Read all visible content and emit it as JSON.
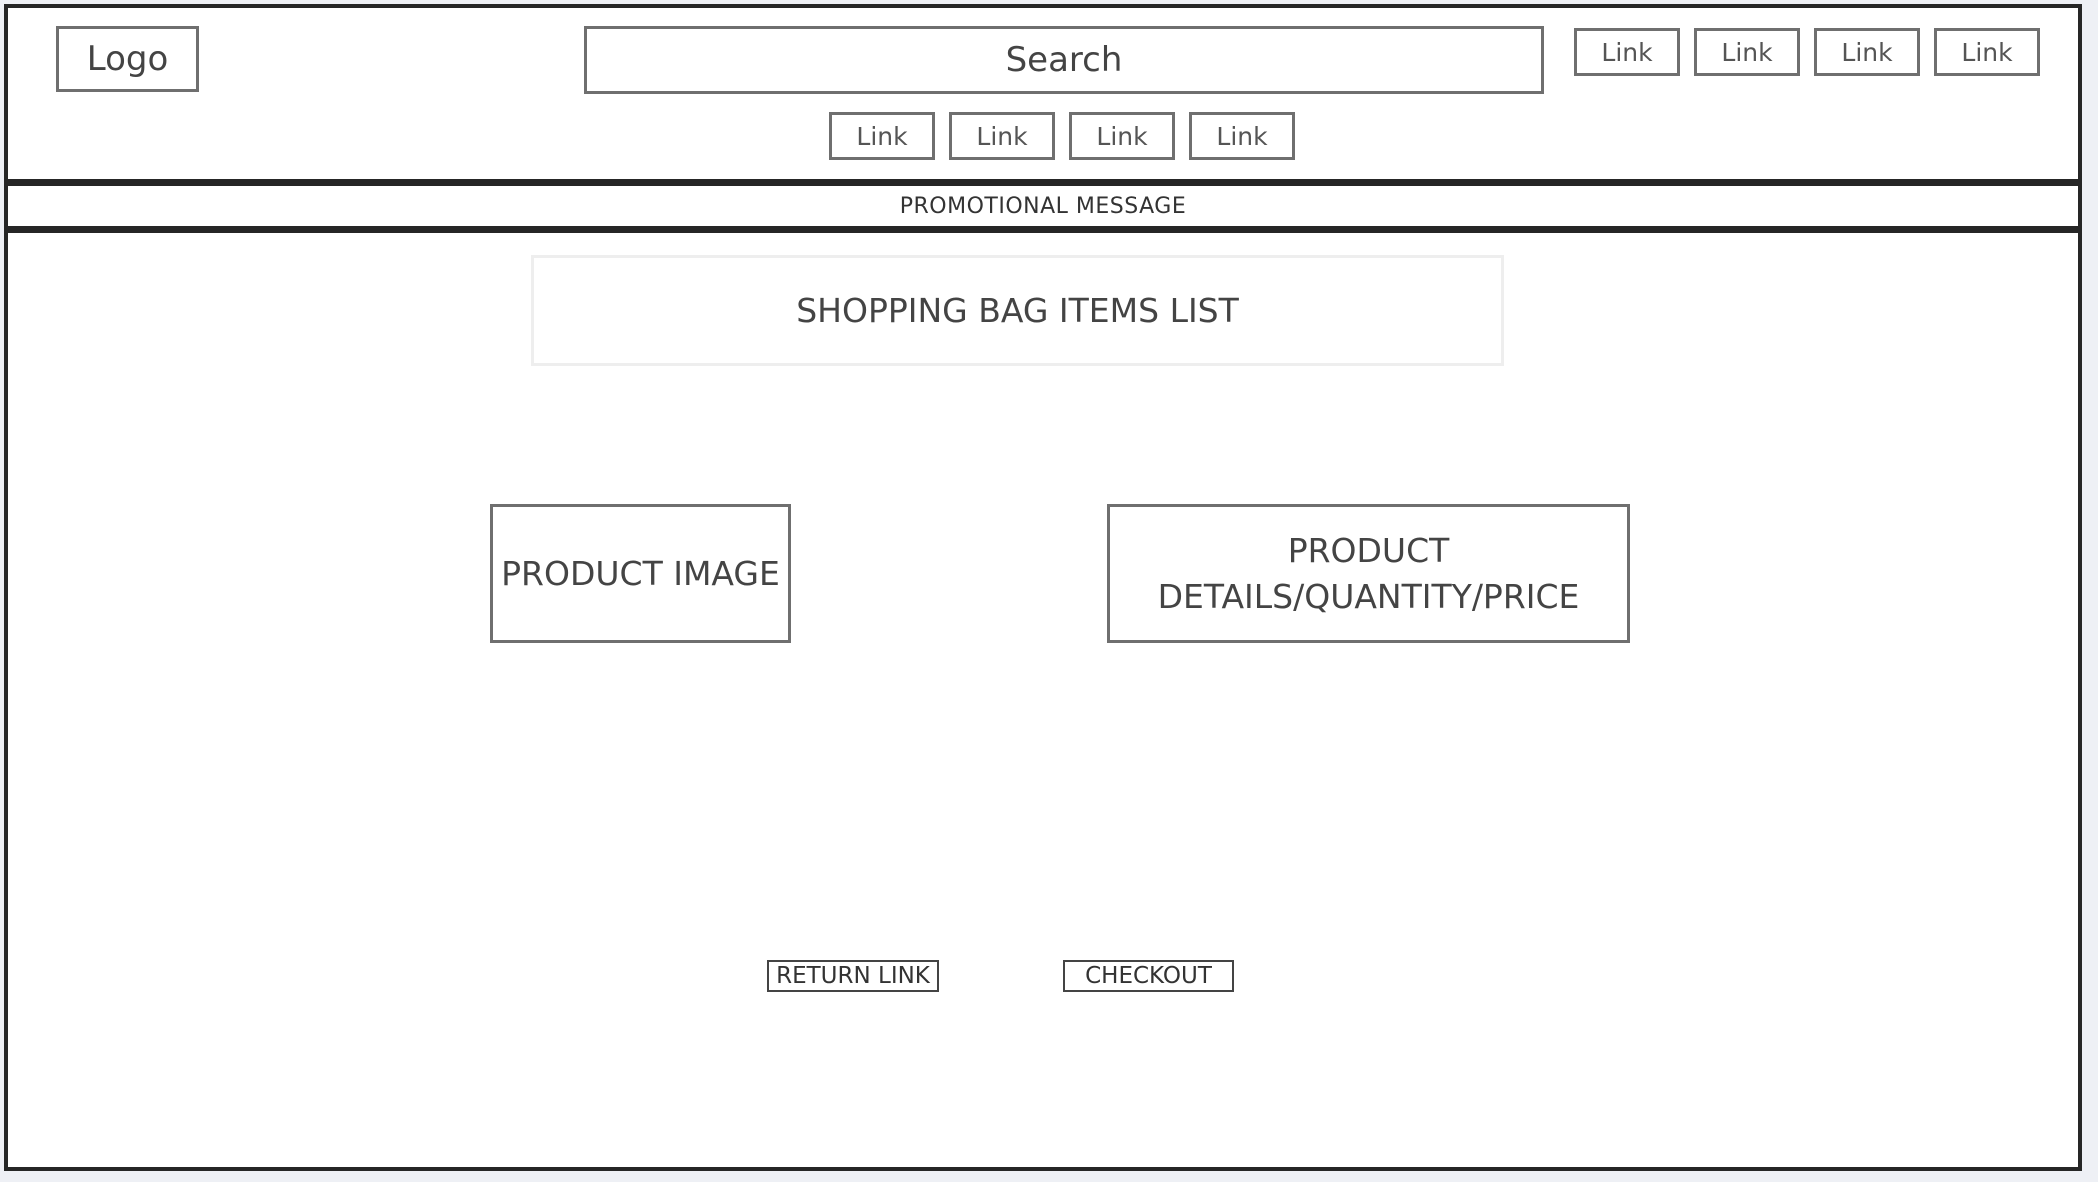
{
  "header": {
    "logo": "Logo",
    "search_label": "Search",
    "top_links": [
      "Link",
      "Link",
      "Link",
      "Link"
    ],
    "nav_links": [
      "Link",
      "Link",
      "Link",
      "Link"
    ]
  },
  "promo": {
    "message": "PROMOTIONAL MESSAGE"
  },
  "main": {
    "list_title": "SHOPPING BAG ITEMS LIST",
    "product_image": "PRODUCT IMAGE",
    "product_details": "PRODUCT DETAILS/QUANTITY/PRICE",
    "return_label": "RETURN LINK",
    "checkout_label": "CHECKOUT"
  },
  "colors": {
    "frame_border": "#262626",
    "box_border": "#6f6f6f",
    "background": "#eef0f5"
  }
}
